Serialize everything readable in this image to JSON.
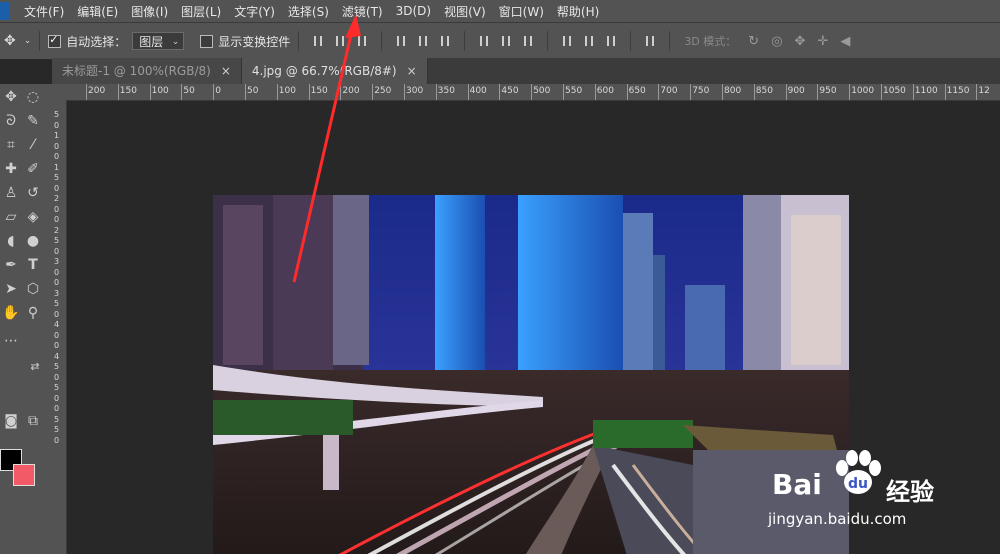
{
  "menubar": {
    "items": [
      "文件(F)",
      "编辑(E)",
      "图像(I)",
      "图层(L)",
      "文字(Y)",
      "选择(S)",
      "滤镜(T)",
      "3D(D)",
      "视图(V)",
      "窗口(W)",
      "帮助(H)"
    ]
  },
  "options": {
    "auto_select_label": "自动选择：",
    "auto_select_value": "图层",
    "show_transform_label": "显示变换控件",
    "mode_3d_label": "3D 模式："
  },
  "tabs": [
    {
      "title": "未标题-1 @ 100%(RGB/8)",
      "close": "×"
    },
    {
      "title": "4.jpg @ 66.7%(RGB/8#)",
      "close": "×"
    }
  ],
  "ruler": {
    "top_labels": [
      "200",
      "150",
      "100",
      "50",
      "0",
      "50",
      "100",
      "150",
      "200",
      "250",
      "300",
      "350",
      "400",
      "450",
      "500",
      "550",
      "600",
      "650",
      "700",
      "750",
      "800",
      "850",
      "900",
      "950",
      "1000",
      "1050",
      "1100",
      "1150",
      "12"
    ],
    "left_labels": [
      "5",
      "0",
      "1",
      "0",
      "0",
      "1",
      "5",
      "0",
      "2",
      "0",
      "0",
      "2",
      "5",
      "0",
      "3",
      "0",
      "0",
      "3",
      "5",
      "0",
      "4",
      "0",
      "0",
      "4",
      "5",
      "0",
      "5",
      "0",
      "0",
      "5",
      "5",
      "0"
    ]
  },
  "watermark": {
    "brand": "Bai",
    "brand_suffix": "经验",
    "url": "jingyan.baidu.com"
  },
  "colors": {
    "foreground": "#000000",
    "background": "#f35a68",
    "annotation_arrow": "#ff2a2a"
  }
}
